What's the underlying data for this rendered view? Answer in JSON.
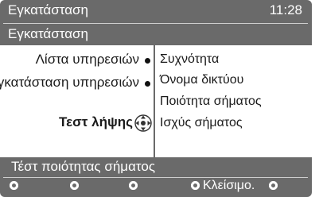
{
  "header": {
    "title": "Εγκατάσταση",
    "time": "11:28",
    "subtitle": "Εγκατάσταση"
  },
  "menu": {
    "items": [
      {
        "label": "Λίστα υπηρεσιών"
      },
      {
        "label": "Εγκατάσταση υπηρεσιών"
      },
      {
        "label": "Τεστ λήψης"
      }
    ],
    "options": [
      {
        "label": "Συχνότητα"
      },
      {
        "label": "Όνομα δικτύου"
      },
      {
        "label": "Ποιότητα σήματος"
      },
      {
        "label": "Ισχύς σήματος"
      }
    ]
  },
  "footer": {
    "status": "Τέστ ποιότητας σήματος",
    "close_label": "Κλείσιμο."
  },
  "colors": {
    "bar": "#6a6a6a",
    "panel": "#ffffff",
    "text": "#1a1a1a"
  }
}
